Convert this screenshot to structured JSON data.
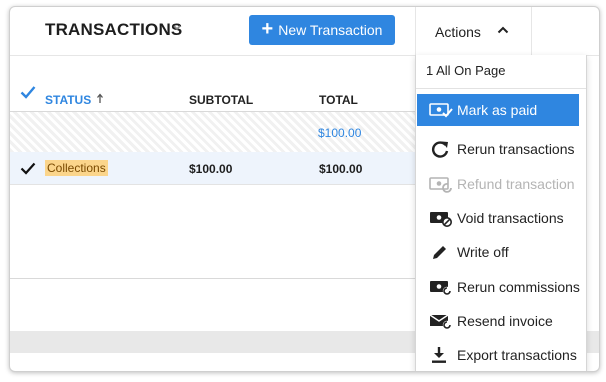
{
  "toolbar": {
    "title": "TRANSACTIONS",
    "new_transaction_label": "New Transaction",
    "actions_label": "Actions"
  },
  "table": {
    "columns": {
      "status": "STATUS",
      "subtotal": "SUBTOTAL",
      "total": "TOTAL"
    },
    "summary_total": "$100.00",
    "rows": [
      {
        "status": "Collections",
        "subtotal": "$100.00",
        "total": "$100.00"
      }
    ]
  },
  "actions_menu": {
    "selection": "1 All On Page",
    "items": [
      {
        "label": "Mark as paid",
        "icon": "mark-paid-icon",
        "state": "active"
      },
      {
        "label": "Rerun transactions",
        "icon": "rerun-icon",
        "state": "normal"
      },
      {
        "label": "Refund transaction",
        "icon": "refund-icon",
        "state": "disabled"
      },
      {
        "label": "Void transactions",
        "icon": "void-icon",
        "state": "normal"
      },
      {
        "label": "Write off",
        "icon": "pencil-icon",
        "state": "normal"
      },
      {
        "label": "Rerun commissions",
        "icon": "rerun-commissions-icon",
        "state": "normal"
      },
      {
        "label": "Resend invoice",
        "icon": "resend-invoice-icon",
        "state": "normal"
      },
      {
        "label": "Export transactions",
        "icon": "download-icon",
        "state": "normal"
      }
    ]
  },
  "colors": {
    "accent": "#2f86e0",
    "highlight": "#fbd58b",
    "row_selected": "#eef4fc"
  }
}
